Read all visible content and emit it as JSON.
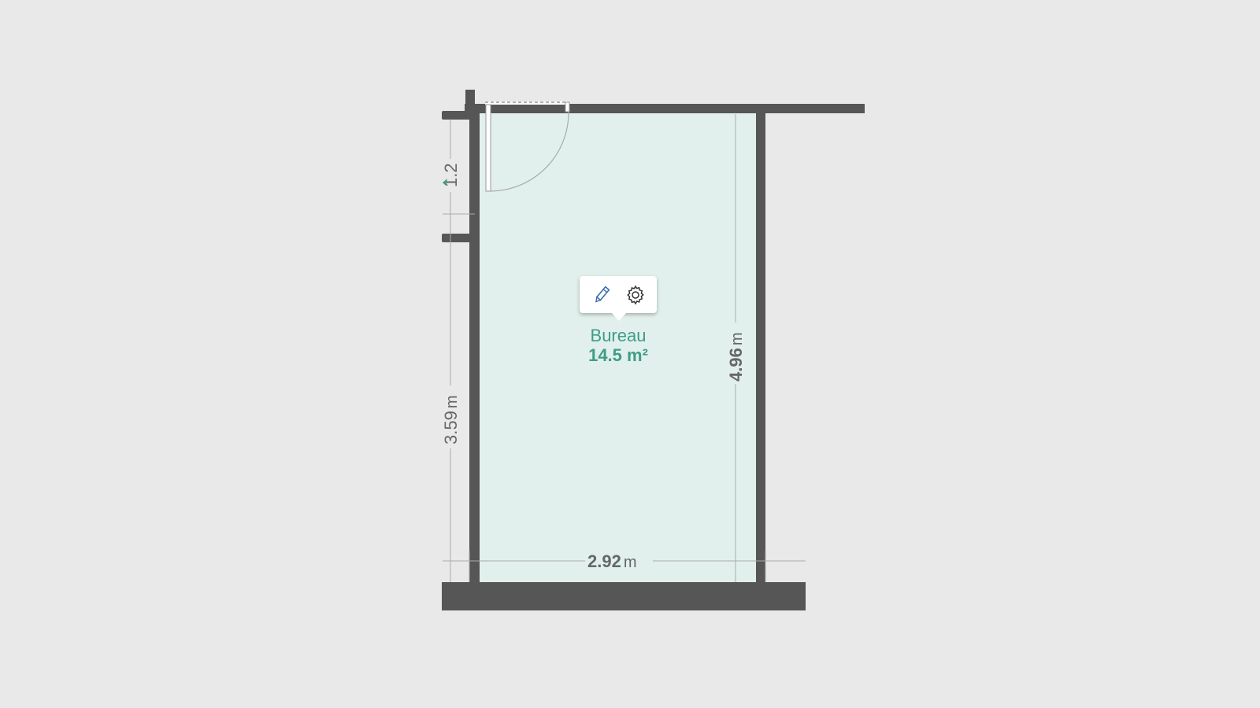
{
  "room": {
    "name": "Bureau",
    "area": "14.5 m²"
  },
  "popup": {
    "edit_icon": "pencil-icon",
    "settings_icon": "gear-icon"
  },
  "dimensions": {
    "left_top_value": "1.2",
    "left_bottom_value": "3.59",
    "left_bottom_unit": "m",
    "right_value": "4.96",
    "right_unit": "m",
    "bottom_value": "2.92",
    "bottom_unit": "m"
  },
  "colors": {
    "background": "#e9e9e9",
    "room_fill": "#e1f0ec",
    "wall": "#565656",
    "label": "#3f9c88",
    "dimension": "#666666"
  }
}
